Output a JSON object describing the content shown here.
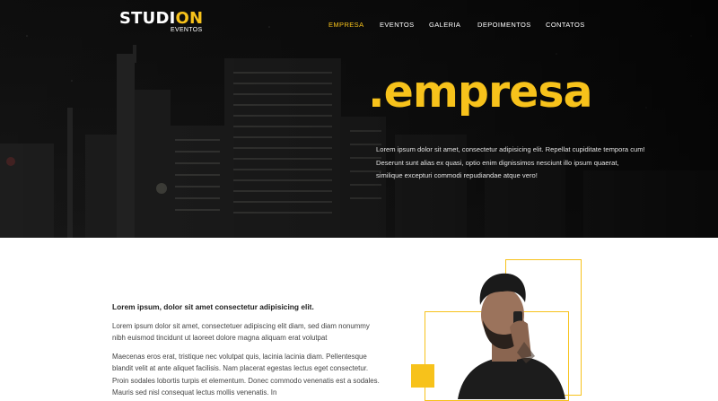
{
  "brand": {
    "logo_main": "STUDI",
    "logo_accent": "ON",
    "logo_sub": "EVENTOS",
    "accent_color": "#f7c21b"
  },
  "nav": {
    "items": [
      "EMPRESA",
      "EVENTOS",
      "GALERIA",
      "DEPOIMENTOS",
      "CONTATOS"
    ],
    "active": "EMPRESA"
  },
  "hero": {
    "title": ".empresa",
    "text": "Lorem ipsum dolor sit amet, consectetur adipisicing elit. Repellat cupiditate tempora cum! Deserunt sunt alias ex quasi, optio enim dignissimos nesciunt illo ipsum quaerat, similique excepturi commodi repudiandae atque vero!"
  },
  "content": {
    "heading": "Lorem ipsum, dolor sit amet consectetur adipisicing elit.",
    "paragraph_1": "Lorem ipsum dolor sit amet, consectetuer adipiscing elit diam, sed diam nonummy nibh euismod tincidunt ut laoreet dolore magna aliquam erat volutpat",
    "paragraph_2": "Maecenas eros erat, tristique nec volutpat quis, lacinia lacinia diam. Pellentesque blandit velit at ante aliquet facilisis. Nam placerat egestas lectus eget consectetur. Proin sodales lobortis turpis et elementum. Donec commodo venenatis est a sodales. Mauris sed nisl consequat lectus mollis venenatis. In"
  }
}
